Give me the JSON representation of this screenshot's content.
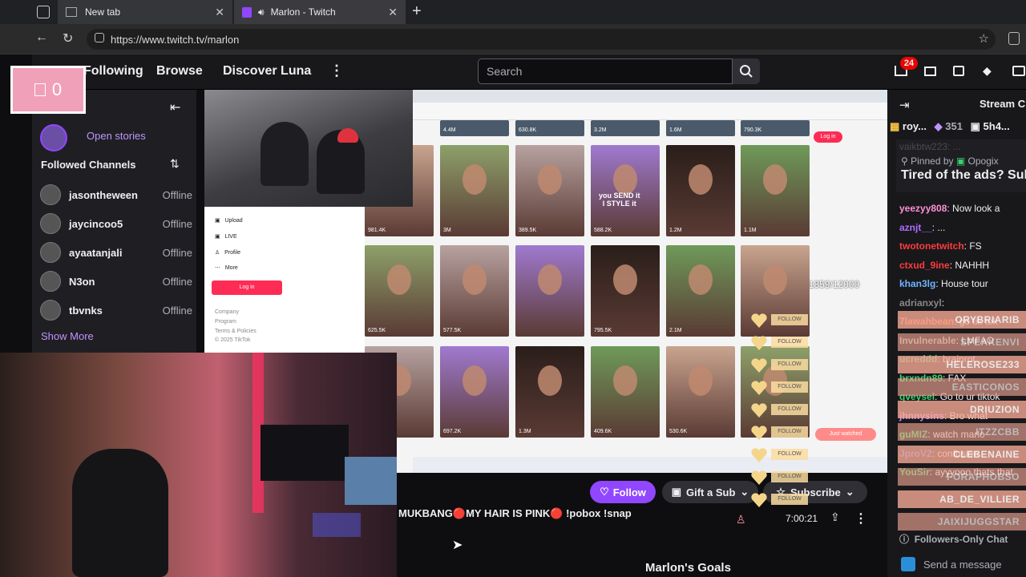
{
  "tabs": [
    {
      "label": "New tab"
    },
    {
      "label": "Marlon - Twitch"
    }
  ],
  "url": "https://www.twitch.tv/marlon",
  "nav": {
    "following": "Following",
    "browse": "Browse",
    "discover": "Discover Luna",
    "search_placeholder": "Search",
    "notification_count": "24"
  },
  "overlay_counter": "0",
  "sidebar": {
    "open_stories": "Open stories",
    "followed_title": "Followed Channels",
    "channels": [
      {
        "name": "jasontheween",
        "status": "Offline"
      },
      {
        "name": "jaycincoo5",
        "status": "Offline"
      },
      {
        "name": "ayaatanjali",
        "status": "Offline"
      },
      {
        "name": "N3on",
        "status": "Offline"
      },
      {
        "name": "tbvnks",
        "status": "Offline"
      }
    ],
    "show_more": "Show More"
  },
  "tiktok": {
    "menu": [
      "Upload",
      "LIVE",
      "Profile",
      "More"
    ],
    "login": "Log in",
    "footer": [
      "Company",
      "Program",
      "Terms & Policies",
      "© 2025 TikTok"
    ],
    "top_views": [
      "4.4M",
      "630.8K",
      "3.2M",
      "1.6M",
      "790.3K"
    ],
    "row1_views": [
      "981.4K",
      "3M",
      "389.5K",
      "588.2K",
      "1.2M",
      "1.1M"
    ],
    "row2_views": [
      "625.5K",
      "577.5K",
      "",
      "795.5K",
      "2.1M",
      ""
    ],
    "row3_views": [
      "",
      "697.2K",
      "1.3M",
      "409.6K",
      "530.6K",
      ""
    ],
    "style_text": "you SEND it\nI STYLE it",
    "just_watched": "Just watched",
    "progress": "11859/12000",
    "login_small": "Log in"
  },
  "follow_tags": [
    "FOLLOW",
    "FOLLOW",
    "FOLLOW",
    "FOLLOW",
    "FOLLOW",
    "FOLLOW",
    "FOLLOW",
    "FOLLOW",
    "FOLLOW"
  ],
  "stream": {
    "follow": "Follow",
    "gift_sub": "Gift a Sub",
    "subscribe": "Subscribe",
    "title": "MUKBANG🔴MY HAIR IS PINK🔴 !pobox !snap",
    "uptime": "7:00:21",
    "goals": "Marlon's Goals"
  },
  "chat": {
    "header": "Stream Chat",
    "leaders": [
      {
        "name": "roy...",
        "score": "351"
      },
      {
        "name": "5h4...",
        "score": ""
      }
    ],
    "pinned_by": "Pinned by",
    "pinned_user": "Opogix",
    "pinned_text": "Tired of the ads? Sub",
    "cut_user": "vaikbtw223: ...",
    "messages": [
      {
        "user": "yeezyy808",
        "text": ": Now look a",
        "color": "#ff8fd6"
      },
      {
        "user": "aznjt__",
        "text": ": ...",
        "color": "#b06bff"
      },
      {
        "user": "twotonetwitch",
        "text": ": FS",
        "color": "#ff3b3b"
      },
      {
        "user": "ctxud_9ine",
        "text": ": NAHHH",
        "color": "#ff3b3b"
      },
      {
        "user": "khan3lg",
        "text": ": House tour",
        "color": "#6fb4ff"
      },
      {
        "user": "adrianxyl",
        "text": ":",
        "color": "#888888"
      },
      {
        "user": "7lawahbean",
        "text": ": go tik tok",
        "color": "#ff6a3d"
      },
      {
        "user": "Invulnerable",
        "text": ": LMFAO",
        "color": "#aaaaaa"
      },
      {
        "user": "ucreddd",
        "text": ": brainrot",
        "color": "#3bd16f"
      },
      {
        "user": "brxndn89",
        "text": ": FAX",
        "color": "#3bd16f"
      },
      {
        "user": "qveysel",
        "text": ": Go to ur tiktok",
        "color": "#3bd16f"
      },
      {
        "user": "jhnnysins",
        "text": ": Bro what",
        "color": "#c48bff"
      },
      {
        "user": "guMIZ",
        "text": ": watch marlo",
        "color": "#3bd16f"
      },
      {
        "user": "JproV2",
        "text": ": confusion",
        "color": "#4a7bff"
      },
      {
        "user": "YouSir",
        "text": ": ayyyooo thats that",
        "color": "#3bd16f"
      }
    ],
    "followers_only": "Followers-Only Chat",
    "send_placeholder": "Send a message"
  },
  "banners": [
    "ORYBRIARIB",
    "SPEAKENVI",
    "HELEROSE233",
    "EASTICONOS",
    "DRIUZION",
    "ITZZCBB",
    "CLEBENAINE",
    "FORAPHOBSO",
    "AB_DE_VILLIER",
    "JAIXIJUGGSTAR"
  ],
  "colors": {
    "twitch_purple": "#9147ff",
    "live_red": "#eb0400"
  }
}
